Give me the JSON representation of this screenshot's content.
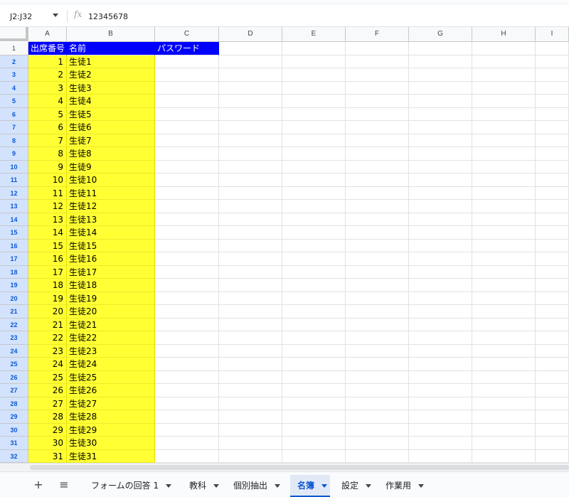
{
  "formula_bar": {
    "name_box": "J2:J32",
    "fx_label": "fx",
    "formula": "12345678"
  },
  "columns": [
    "A",
    "B",
    "C",
    "D",
    "E",
    "F",
    "G",
    "H",
    "I"
  ],
  "row_numbers": [
    "1",
    "2",
    "3",
    "4",
    "5",
    "6",
    "7",
    "8",
    "9",
    "10",
    "11",
    "12",
    "13",
    "14",
    "15",
    "16",
    "17",
    "18",
    "19",
    "20",
    "21",
    "22",
    "23",
    "24",
    "25",
    "26",
    "27",
    "28",
    "29",
    "30",
    "31",
    "32"
  ],
  "header_row": {
    "a": "出席番号",
    "b": "名前",
    "c": "パスワード"
  },
  "rows": [
    {
      "num": "1",
      "name": "生徒1"
    },
    {
      "num": "2",
      "name": "生徒2"
    },
    {
      "num": "3",
      "name": "生徒3"
    },
    {
      "num": "4",
      "name": "生徒4"
    },
    {
      "num": "5",
      "name": "生徒5"
    },
    {
      "num": "6",
      "name": "生徒6"
    },
    {
      "num": "7",
      "name": "生徒7"
    },
    {
      "num": "8",
      "name": "生徒8"
    },
    {
      "num": "9",
      "name": "生徒9"
    },
    {
      "num": "10",
      "name": "生徒10"
    },
    {
      "num": "11",
      "name": "生徒11"
    },
    {
      "num": "12",
      "name": "生徒12"
    },
    {
      "num": "13",
      "name": "生徒13"
    },
    {
      "num": "14",
      "name": "生徒14"
    },
    {
      "num": "15",
      "name": "生徒15"
    },
    {
      "num": "16",
      "name": "生徒16"
    },
    {
      "num": "17",
      "name": "生徒17"
    },
    {
      "num": "18",
      "name": "生徒18"
    },
    {
      "num": "19",
      "name": "生徒19"
    },
    {
      "num": "20",
      "name": "生徒20"
    },
    {
      "num": "21",
      "name": "生徒21"
    },
    {
      "num": "22",
      "name": "生徒22"
    },
    {
      "num": "23",
      "name": "生徒23"
    },
    {
      "num": "24",
      "name": "生徒24"
    },
    {
      "num": "25",
      "name": "生徒25"
    },
    {
      "num": "26",
      "name": "生徒26"
    },
    {
      "num": "27",
      "name": "生徒27"
    },
    {
      "num": "28",
      "name": "生徒28"
    },
    {
      "num": "29",
      "name": "生徒29"
    },
    {
      "num": "30",
      "name": "生徒30"
    },
    {
      "num": "31",
      "name": "生徒31"
    }
  ],
  "tabbar": {
    "add_icon": "+",
    "menu_icon": "≡",
    "tabs": [
      {
        "label": "フォームの回答 1",
        "active": false
      },
      {
        "label": "教科",
        "active": false
      },
      {
        "label": "個別抽出",
        "active": false
      },
      {
        "label": "名簿",
        "active": true
      },
      {
        "label": "設定",
        "active": false
      },
      {
        "label": "作業用",
        "active": false
      }
    ]
  },
  "colors": {
    "header_fill": "#0000ff",
    "data_fill": "#ffff33",
    "selection": "#d3e3fd",
    "active_tab": "#0b57d0"
  }
}
